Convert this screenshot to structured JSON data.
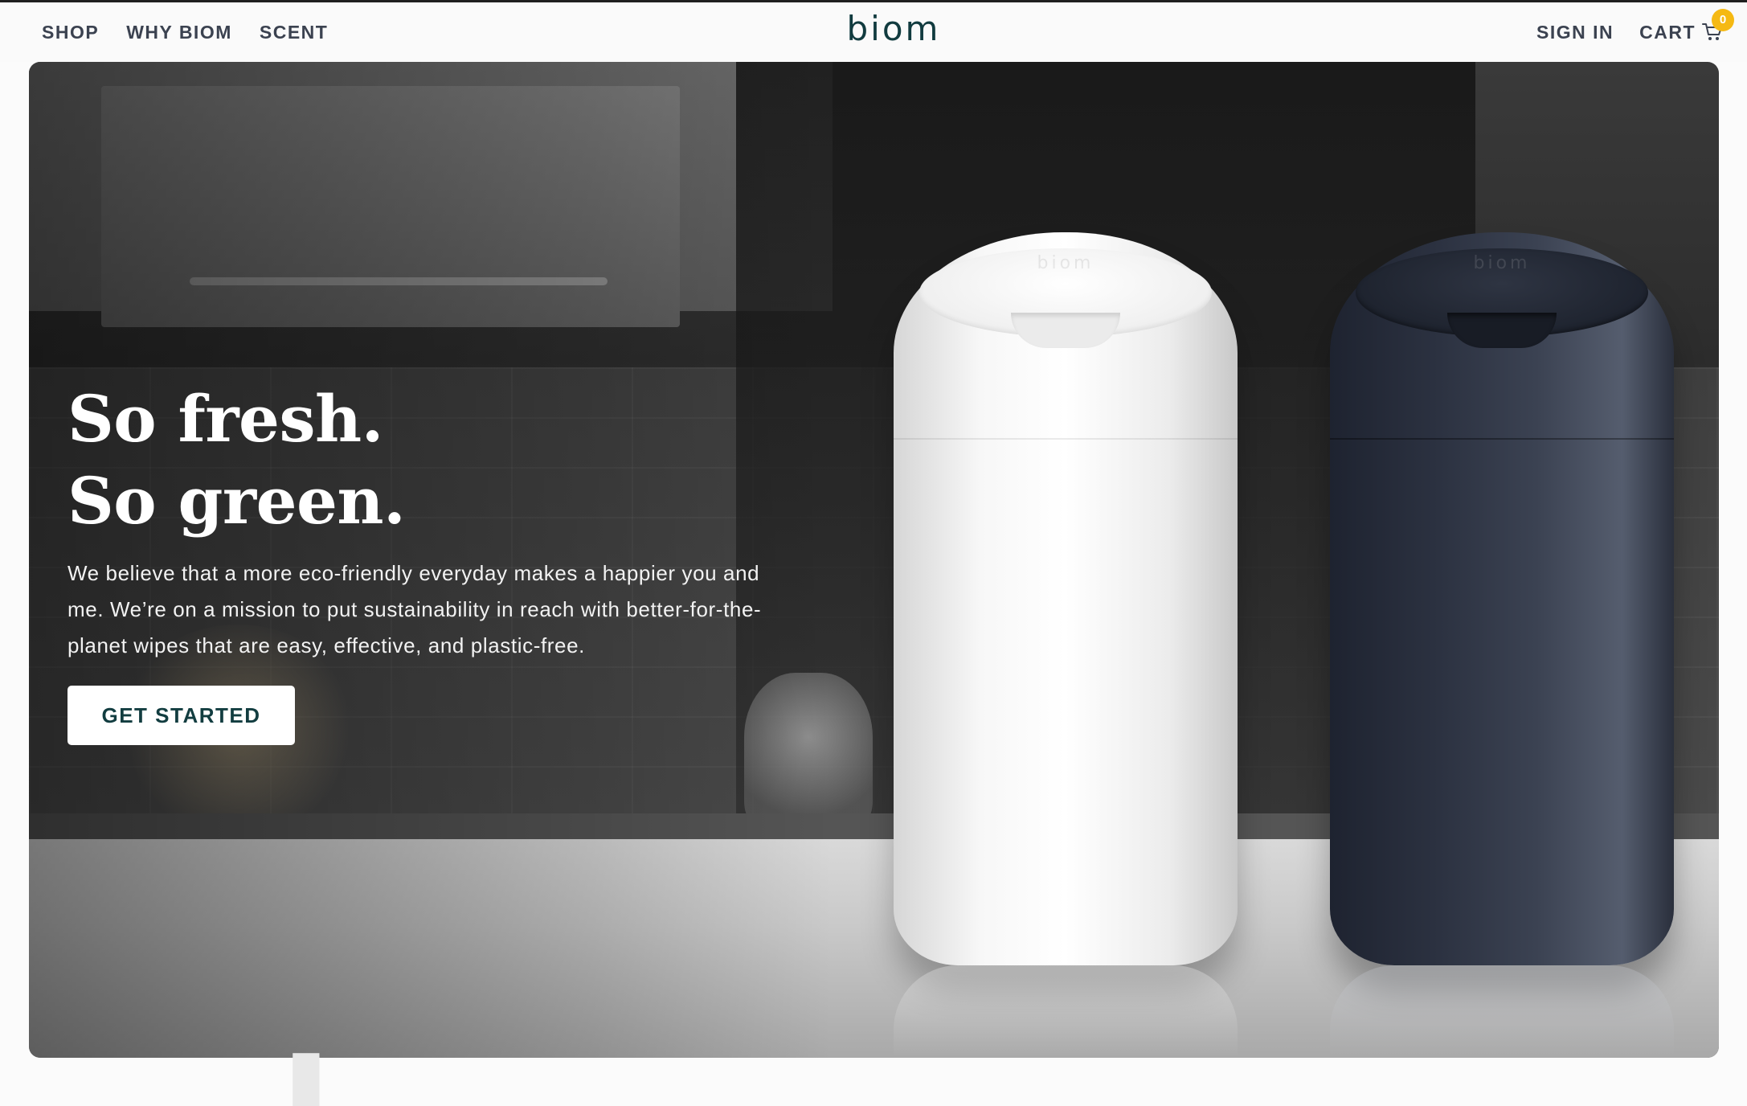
{
  "nav": {
    "left_links": [
      "SHOP",
      "WHY BIOM",
      "SCENT"
    ],
    "logo": "biom",
    "sign_in": "SIGN IN",
    "cart_label": "CART",
    "cart_count": "0"
  },
  "hero": {
    "headline_line1": "So fresh.",
    "headline_line2": "So green.",
    "subcopy": "We believe that a more eco-friendly everyday makes a happier you and me. We’re on a mission to put sustainability in reach with better-for-the-planet wipes that are easy, effective, and plastic-free.",
    "cta_label": "GET STARTED",
    "product_mark": "biom"
  },
  "colors": {
    "brand": "#113b3f",
    "badge": "#f5b913",
    "nav_text": "#3b4250"
  },
  "icons": [
    "cart-icon"
  ]
}
